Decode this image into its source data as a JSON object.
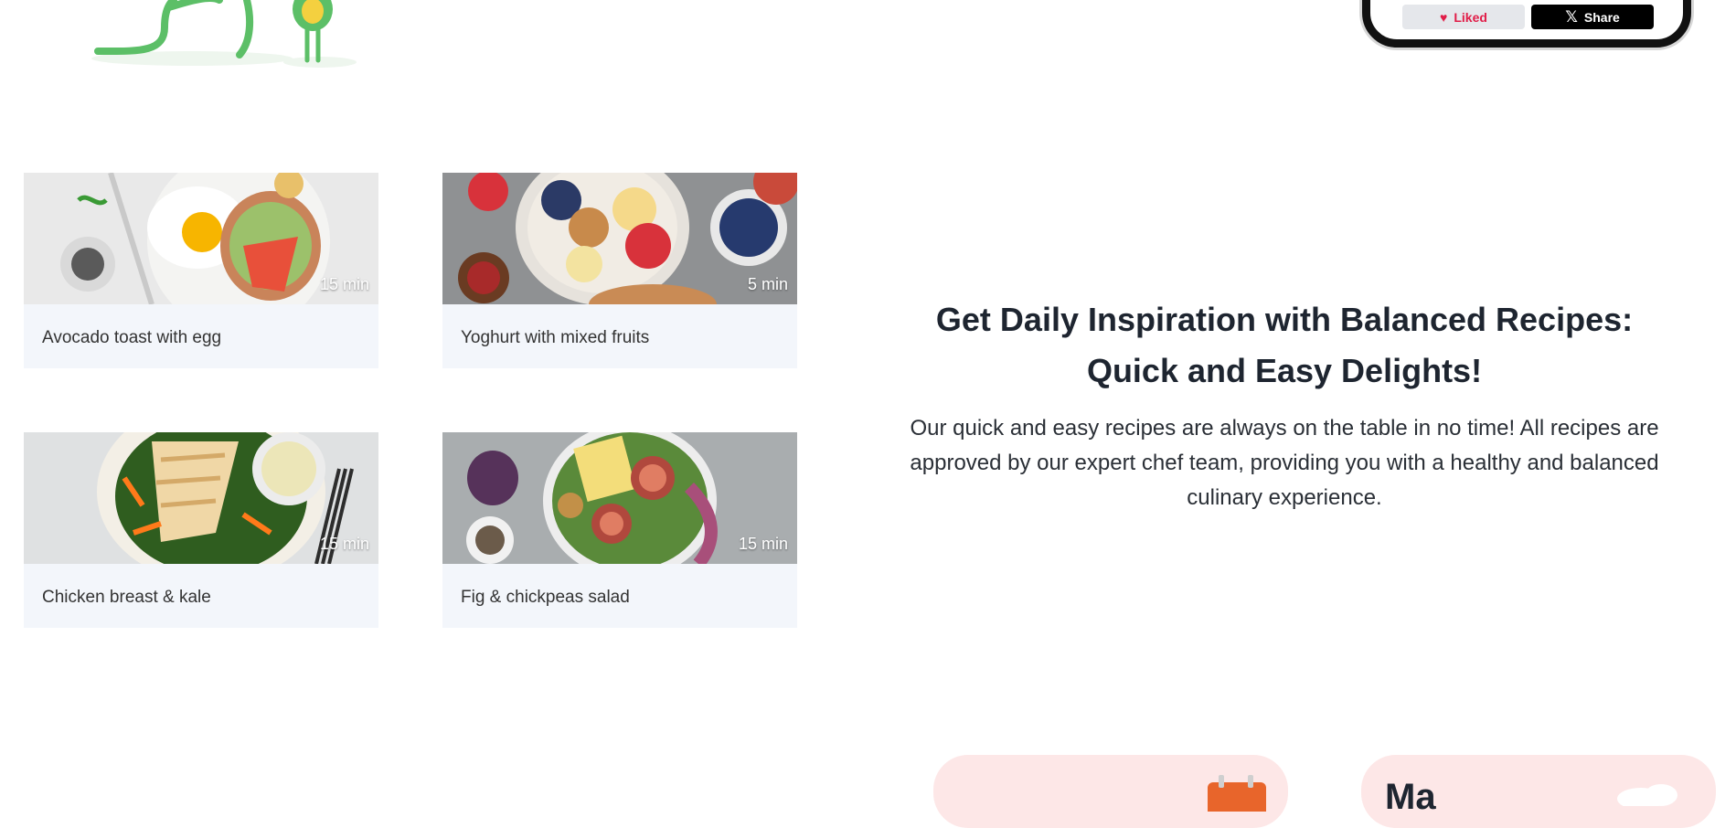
{
  "phone": {
    "liked_label": "Liked",
    "share_label": "Share"
  },
  "recipes": [
    {
      "title": "Avocado toast with egg",
      "time": "15 min"
    },
    {
      "title": "Yoghurt with mixed fruits",
      "time": "5 min"
    },
    {
      "title": "Chicken breast & kale",
      "time": "15 min"
    },
    {
      "title": "Fig & chickpeas salad",
      "time": "15 min"
    }
  ],
  "info": {
    "title": "Get Daily Inspiration with Balanced Recipes: Quick and Easy Delights!",
    "text": "Our quick and easy recipes are always on the table in no time! All recipes are approved by our expert chef team, providing you with a healthy and balanced culinary experience."
  },
  "bottom_cards": [
    {
      "title": ""
    },
    {
      "title": "Ma"
    }
  ]
}
